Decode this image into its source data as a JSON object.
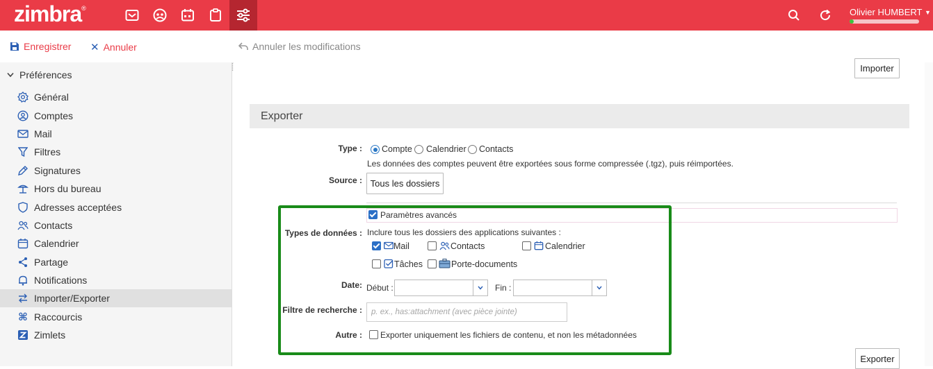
{
  "app": {
    "logo": "zimbra",
    "user_name": "Olivier HUMBERT",
    "quota_fraction": 0.06,
    "brand_color": "#ea3b47",
    "accent_color": "#2b6fc6",
    "highlight_color": "#198b19"
  },
  "toolbar": {
    "save_label": "Enregistrer",
    "cancel_label": "Annuler",
    "undo_label": "Annuler les modifications"
  },
  "sidebar": {
    "header": "Préférences",
    "items": [
      {
        "label": "Général",
        "icon": "gear-icon"
      },
      {
        "label": "Comptes",
        "icon": "account-icon"
      },
      {
        "label": "Mail",
        "icon": "mail-icon"
      },
      {
        "label": "Filtres",
        "icon": "filter-icon"
      },
      {
        "label": "Signatures",
        "icon": "signature-icon"
      },
      {
        "label": "Hors du bureau",
        "icon": "out-of-office-icon"
      },
      {
        "label": "Adresses acceptées",
        "icon": "shield-icon"
      },
      {
        "label": "Contacts",
        "icon": "contacts-icon"
      },
      {
        "label": "Calendrier",
        "icon": "calendar-icon"
      },
      {
        "label": "Partage",
        "icon": "share-icon"
      },
      {
        "label": "Notifications",
        "icon": "bell-icon"
      },
      {
        "label": "Importer/Exporter",
        "icon": "import-export-icon",
        "selected": true
      },
      {
        "label": "Raccourcis",
        "icon": "command-icon"
      },
      {
        "label": "Zimlets",
        "icon": "zimlet-icon"
      }
    ]
  },
  "main": {
    "import_button": "Importer",
    "export_button": "Exporter",
    "section_title": "Exporter",
    "type": {
      "label": "Type :",
      "options": [
        "Compte",
        "Calendrier",
        "Contacts"
      ],
      "selected": "Compte",
      "description": "Les données des comptes peuvent être exportées sous forme compressée (.tgz), puis réimportées."
    },
    "source": {
      "label": "Source :",
      "button": "Tous les dossiers"
    },
    "advanced": {
      "label": "Paramètres avancés",
      "checked": true
    },
    "data_types": {
      "label": "Types de données :",
      "description": "Inclure tous les dossiers des applications suivantes :",
      "items": [
        {
          "label": "Mail",
          "checked": true,
          "icon": "mail-icon"
        },
        {
          "label": "Contacts",
          "checked": false,
          "icon": "contacts-icon"
        },
        {
          "label": "Calendrier",
          "checked": false,
          "icon": "calendar-icon"
        },
        {
          "label": "Tâches",
          "checked": false,
          "icon": "tasks-icon"
        },
        {
          "label": "Porte-documents",
          "checked": false,
          "icon": "briefcase-icon"
        }
      ]
    },
    "date": {
      "label": "Date:",
      "start_label": "Début :",
      "end_label": "Fin :"
    },
    "search_filter": {
      "label": "Filtre de recherche :",
      "placeholder": "p. ex., has:attachment (avec pièce jointe)"
    },
    "other": {
      "label": "Autre :",
      "option": "Exporter uniquement les fichiers de contenu, et non les métadonnées",
      "checked": false
    }
  }
}
